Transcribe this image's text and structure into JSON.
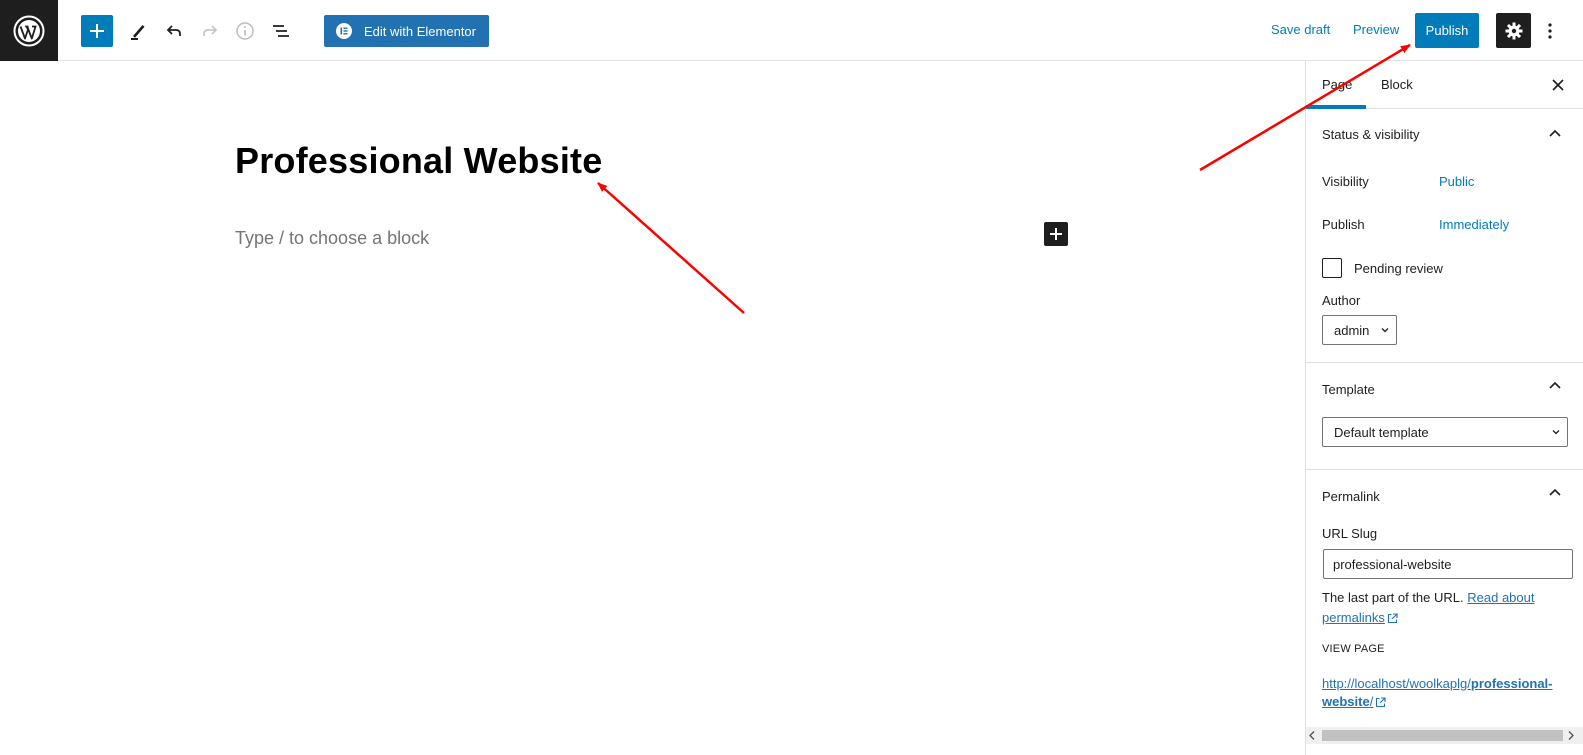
{
  "toolbar": {
    "elementor_label": "Edit with Elementor",
    "save_draft_label": "Save draft",
    "preview_label": "Preview",
    "publish_label": "Publish"
  },
  "editor": {
    "title": "Professional Website",
    "block_placeholder": "Type / to choose a block"
  },
  "sidebar": {
    "tabs": [
      {
        "label": "Page",
        "active": true
      },
      {
        "label": "Block",
        "active": false
      }
    ],
    "status_panel": {
      "title": "Status & visibility",
      "visibility_label": "Visibility",
      "visibility_value": "Public",
      "publish_label": "Publish",
      "publish_value": "Immediately",
      "pending_review_label": "Pending review",
      "pending_review_checked": false,
      "author_label": "Author",
      "author_value": "admin"
    },
    "template_panel": {
      "title": "Template",
      "template_value": "Default template"
    },
    "permalink_panel": {
      "title": "Permalink",
      "url_slug_label": "URL Slug",
      "url_slug_value": "professional-website",
      "help_text": "The last part of the URL.",
      "help_link": "Read about permalinks",
      "view_page_label": "VIEW PAGE",
      "url_base": "http://localhost/woolkaplg/",
      "url_slug_bold": "professional-website",
      "url_tail": "/"
    }
  },
  "colors": {
    "accent": "#007cba",
    "elementor": "#2271b1",
    "dark": "#1e1e1e",
    "annotation_arrow": "#ff0000"
  }
}
